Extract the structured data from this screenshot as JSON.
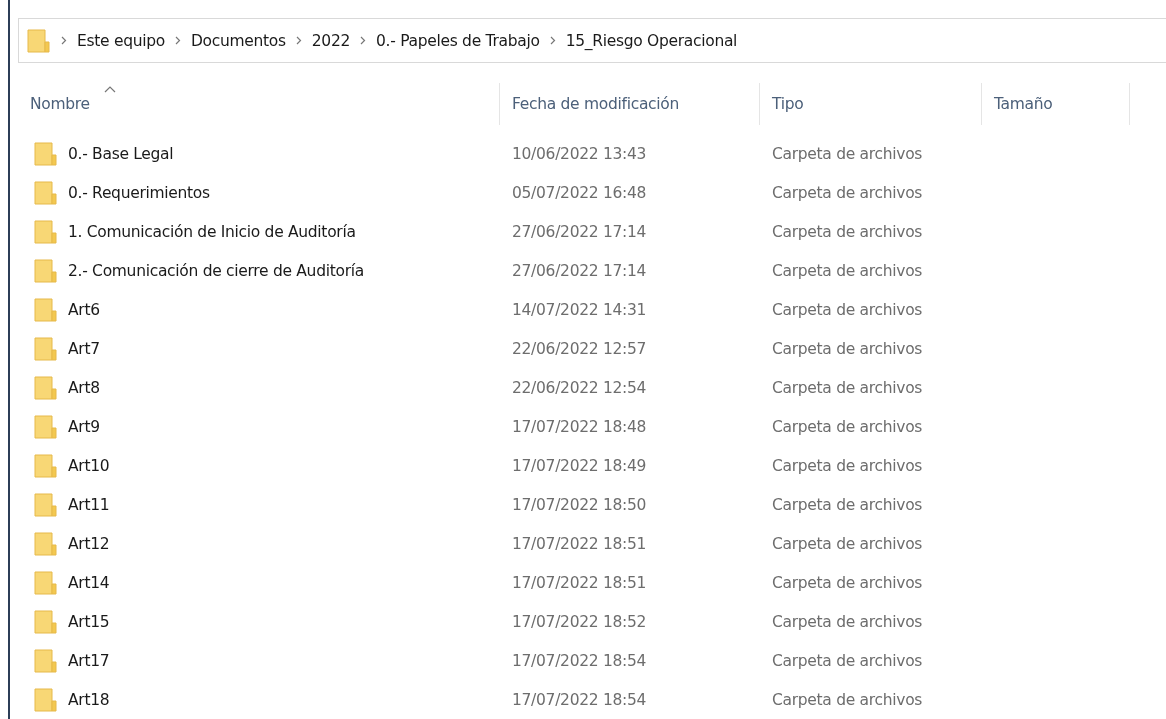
{
  "breadcrumb": [
    "Este equipo",
    "Documentos",
    "2022",
    "0.- Papeles de Trabajo",
    "15_Riesgo Operacional"
  ],
  "table": {
    "columns": [
      {
        "label": "Nombre",
        "sorted": true
      },
      {
        "label": "Fecha de modificación",
        "sorted": false
      },
      {
        "label": "Tipo",
        "sorted": false
      },
      {
        "label": "Tamaño",
        "sorted": false
      }
    ],
    "rows": [
      {
        "name": "0.- Base Legal",
        "date": "10/06/2022 13:43",
        "type": "Carpeta de archivos"
      },
      {
        "name": "0.- Requerimientos",
        "date": "05/07/2022 16:48",
        "type": "Carpeta de archivos"
      },
      {
        "name": "1. Comunicación de Inicio de Auditoría",
        "date": "27/06/2022 17:14",
        "type": "Carpeta de archivos"
      },
      {
        "name": "2.- Comunicación de cierre de Auditoría",
        "date": "27/06/2022 17:14",
        "type": "Carpeta de archivos"
      },
      {
        "name": "Art6",
        "date": "14/07/2022 14:31",
        "type": "Carpeta de archivos"
      },
      {
        "name": "Art7",
        "date": "22/06/2022 12:57",
        "type": "Carpeta de archivos"
      },
      {
        "name": "Art8",
        "date": "22/06/2022 12:54",
        "type": "Carpeta de archivos"
      },
      {
        "name": "Art9",
        "date": "17/07/2022 18:48",
        "type": "Carpeta de archivos"
      },
      {
        "name": "Art10",
        "date": "17/07/2022 18:49",
        "type": "Carpeta de archivos"
      },
      {
        "name": "Art11",
        "date": "17/07/2022 18:50",
        "type": "Carpeta de archivos"
      },
      {
        "name": "Art12",
        "date": "17/07/2022 18:51",
        "type": "Carpeta de archivos"
      },
      {
        "name": "Art14",
        "date": "17/07/2022 18:51",
        "type": "Carpeta de archivos"
      },
      {
        "name": "Art15",
        "date": "17/07/2022 18:52",
        "type": "Carpeta de archivos"
      },
      {
        "name": "Art17",
        "date": "17/07/2022 18:54",
        "type": "Carpeta de archivos"
      },
      {
        "name": "Art18",
        "date": "17/07/2022 18:54",
        "type": "Carpeta de archivos"
      }
    ]
  }
}
